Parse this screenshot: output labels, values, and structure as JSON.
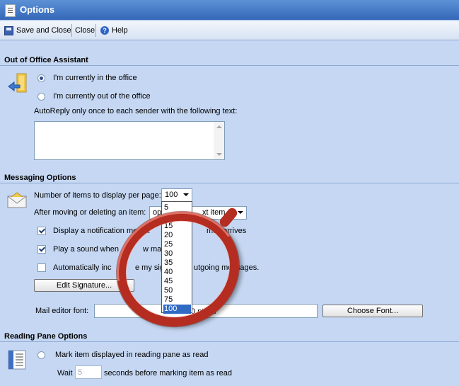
{
  "window": {
    "title": "Options"
  },
  "toolbar": {
    "save_close": "Save and Close",
    "close": "Close",
    "help": "Help",
    "help_glyph": "?"
  },
  "out_of_office": {
    "heading": "Out of Office Assistant",
    "option_in": "I'm currently in the office",
    "option_out": "I'm currently out of the office",
    "selected": "in",
    "autoreply_label": "AutoReply only once to each sender with the following text:",
    "autoreply_text": ""
  },
  "messaging": {
    "heading": "Messaging Options",
    "items_per_page_label": "Number of items to display per page:",
    "items_per_page_value": "100",
    "items_per_page_options": [
      "5",
      "10",
      "15",
      "20",
      "25",
      "30",
      "35",
      "40",
      "45",
      "50",
      "75",
      "100"
    ],
    "after_move_label": "After moving or deleting an item:",
    "after_move_value_left": "op",
    "after_move_value_right": "xt item",
    "notify_left": "Display a notification messa",
    "notify_right": "mail arrives",
    "notify_checked": true,
    "sound_left": "Play a sound when",
    "sound_right": "w mail arri",
    "sound_checked": true,
    "signature_left": "Automatically inc",
    "signature_mid": "e my signatu",
    "signature_right": "utgoing messages.",
    "signature_checked": false,
    "edit_signature_label": "Edit Signature...",
    "font_label": "Mail editor font:",
    "font_value": "0 pt, ial",
    "choose_font_label": "Choose Font..."
  },
  "reading_pane": {
    "heading": "Reading Pane Options",
    "mark_read_label": "Mark item displayed in reading pane as read",
    "wait_label": "Wait",
    "wait_value": "5",
    "seconds_label": "seconds before marking item as read"
  },
  "colors": {
    "title_bar": "#3468b8",
    "background": "#c5d7f2",
    "highlight": "#316ac5",
    "annotation": "#b52c20"
  }
}
